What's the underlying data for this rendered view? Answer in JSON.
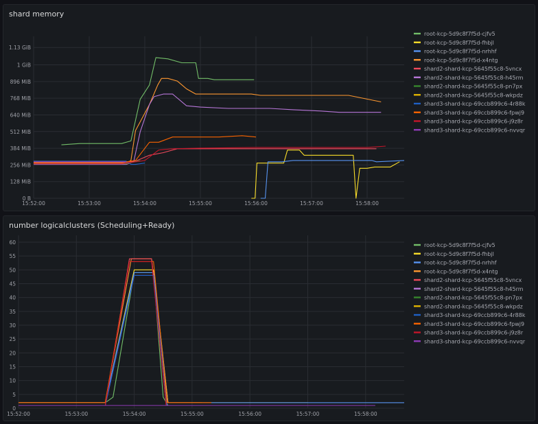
{
  "panels": [
    {
      "title": "shard memory"
    },
    {
      "title": "number logicalclusters (Scheduling+Ready)"
    }
  ],
  "chart_data": [
    {
      "type": "line",
      "title": "shard memory",
      "x_ticks": [
        "15:52:00",
        "15:53:00",
        "15:54:00",
        "15:55:00",
        "15:56:00",
        "15:57:00",
        "15:58:00"
      ],
      "y_ticks": [
        "0 B",
        "128 MiB",
        "256 MiB",
        "384 MiB",
        "512 MiB",
        "640 MiB",
        "768 MiB",
        "896 MiB",
        "1 GiB",
        "1.13 GiB"
      ],
      "y_unit": "MiB",
      "ylim": [
        0,
        1190
      ],
      "x_range": [
        "15:52:00",
        "15:58:40"
      ],
      "grid": true,
      "legend_position": "right",
      "series": [
        {
          "name": "root-kcp-5d9c8f7f5d-cjfv5",
          "color": "#73bf69",
          "points": [
            [
              "15:52:30",
              410
            ],
            [
              "15:52:50",
              420
            ],
            [
              "15:53:35",
              420
            ],
            [
              "15:53:45",
              440
            ],
            [
              "15:53:55",
              760
            ],
            [
              "15:54:05",
              870
            ],
            [
              "15:54:12",
              1080
            ],
            [
              "15:54:25",
              1070
            ],
            [
              "15:54:40",
              1040
            ],
            [
              "15:54:55",
              1040
            ],
            [
              "15:54:58",
              920
            ],
            [
              "15:55:08",
              920
            ],
            [
              "15:55:15",
              910
            ],
            [
              "15:55:58",
              910
            ]
          ]
        },
        {
          "name": "root-kcp-5d9c8f7f5d-fhbjl",
          "color": "#fade2a",
          "points": [
            [
              "15:55:55",
              0
            ],
            [
              "15:55:59",
              0
            ],
            [
              "15:56:01",
              270
            ],
            [
              "15:56:30",
              270
            ],
            [
              "15:56:34",
              370
            ],
            [
              "15:56:47",
              370
            ],
            [
              "15:56:52",
              330
            ],
            [
              "15:57:30",
              330
            ],
            [
              "15:57:45",
              330
            ],
            [
              "15:57:48",
              0
            ],
            [
              "15:57:52",
              230
            ],
            [
              "15:58:00",
              230
            ],
            [
              "15:58:08",
              240
            ],
            [
              "15:58:25",
              240
            ],
            [
              "15:58:35",
              280
            ]
          ]
        },
        {
          "name": "root-kcp-5d9c8f7f5d-nrhhf",
          "color": "#5794f2",
          "points": [
            [
              "15:56:05",
              0
            ],
            [
              "15:56:10",
              0
            ],
            [
              "15:56:13",
              280
            ],
            [
              "15:56:28",
              280
            ],
            [
              "15:56:40",
              290
            ],
            [
              "15:57:25",
              290
            ],
            [
              "15:57:48",
              290
            ],
            [
              "15:58:00",
              290
            ],
            [
              "15:58:05",
              290
            ],
            [
              "15:58:10",
              280
            ],
            [
              "15:58:40",
              290
            ]
          ]
        },
        {
          "name": "root-kcp-5d9c8f7f5d-x4ntg",
          "color": "#ff9830",
          "points": [
            [
              "15:52:00",
              270
            ],
            [
              "15:53:40",
              270
            ],
            [
              "15:53:45",
              290
            ],
            [
              "15:53:50",
              520
            ],
            [
              "15:54:05",
              720
            ],
            [
              "15:54:14",
              870
            ],
            [
              "15:54:18",
              920
            ],
            [
              "15:54:25",
              920
            ],
            [
              "15:54:35",
              900
            ],
            [
              "15:54:45",
              840
            ],
            [
              "15:54:55",
              800
            ],
            [
              "15:55:55",
              800
            ],
            [
              "15:56:05",
              790
            ],
            [
              "15:57:40",
              790
            ],
            [
              "15:58:15",
              740
            ]
          ]
        },
        {
          "name": "shard2-shard-kcp-5645f55c8-5vncx",
          "color": "#f2495c",
          "points": [
            [
              "15:52:00",
              275
            ],
            [
              "15:53:35",
              275
            ],
            [
              "15:53:50",
              285
            ],
            [
              "15:54:05",
              330
            ],
            [
              "15:54:20",
              350
            ],
            [
              "15:54:35",
              380
            ],
            [
              "15:55:00",
              380
            ],
            [
              "15:56:30",
              380
            ],
            [
              "15:57:30",
              380
            ],
            [
              "15:58:10",
              380
            ]
          ]
        },
        {
          "name": "shard2-shard-kcp-5645f55c8-h45rm",
          "color": "#b877d9",
          "points": [
            [
              "15:52:00",
              260
            ],
            [
              "15:53:40",
              260
            ],
            [
              "15:53:48",
              280
            ],
            [
              "15:53:55",
              510
            ],
            [
              "15:54:05",
              720
            ],
            [
              "15:54:10",
              780
            ],
            [
              "15:54:20",
              800
            ],
            [
              "15:54:30",
              800
            ],
            [
              "15:54:45",
              710
            ],
            [
              "15:55:00",
              700
            ],
            [
              "15:55:30",
              690
            ],
            [
              "15:55:45",
              690
            ],
            [
              "15:56:15",
              690
            ],
            [
              "15:56:40",
              680
            ],
            [
              "15:57:10",
              670
            ],
            [
              "15:57:30",
              660
            ],
            [
              "15:58:00",
              660
            ],
            [
              "15:58:15",
              660
            ]
          ]
        },
        {
          "name": "shard2-shard-kcp-5645f55c8-pn7px",
          "color": "#37872d",
          "points": [
            [
              "15:52:00",
              265
            ],
            [
              "15:53:40",
              265
            ],
            [
              "15:53:55",
              290
            ]
          ]
        },
        {
          "name": "shard2-shard-kcp-5645f55c8-wkpdz",
          "color": "#e0b400",
          "points": [
            [
              "15:52:00",
              285
            ],
            [
              "15:53:40",
              285
            ]
          ]
        },
        {
          "name": "shard3-shard-kcp-69ccb899c6-4r88k",
          "color": "#1f60c4",
          "points": [
            [
              "15:52:00",
              285
            ],
            [
              "15:53:40",
              285
            ],
            [
              "15:53:45",
              260
            ],
            [
              "15:53:50",
              260
            ],
            [
              "15:54:00",
              270
            ]
          ]
        },
        {
          "name": "shard3-shard-kcp-69ccb899c6-fpwj9",
          "color": "#fa6400",
          "points": [
            [
              "15:52:00",
              275
            ],
            [
              "15:53:35",
              275
            ],
            [
              "15:53:50",
              290
            ],
            [
              "15:54:05",
              430
            ],
            [
              "15:54:15",
              430
            ],
            [
              "15:54:30",
              470
            ],
            [
              "15:54:45",
              470
            ],
            [
              "15:55:20",
              470
            ],
            [
              "15:55:45",
              480
            ],
            [
              "15:56:00",
              470
            ]
          ]
        },
        {
          "name": "shard3-shard-kcp-69ccb899c6-j9z8r",
          "color": "#c4162a",
          "points": [
            [
              "15:52:00",
              265
            ],
            [
              "15:53:35",
              265
            ],
            [
              "15:54:00",
              290
            ],
            [
              "15:54:15",
              370
            ],
            [
              "15:54:30",
              380
            ],
            [
              "15:55:00",
              385
            ],
            [
              "15:56:00",
              390
            ],
            [
              "15:57:00",
              390
            ],
            [
              "15:58:00",
              390
            ],
            [
              "15:58:20",
              400
            ]
          ]
        },
        {
          "name": "shard3-shard-kcp-69ccb899c6-nvvqr",
          "color": "#8f3bb8",
          "points": [
            [
              "15:52:00",
              280
            ],
            [
              "15:53:40",
              280
            ]
          ]
        }
      ]
    },
    {
      "type": "line",
      "title": "number logicalclusters (Scheduling+Ready)",
      "x_ticks": [
        "15:52:00",
        "15:53:00",
        "15:54:00",
        "15:55:00",
        "15:56:00",
        "15:57:00",
        "15:58:00"
      ],
      "y_ticks": [
        "0",
        "5",
        "10",
        "15",
        "20",
        "25",
        "30",
        "35",
        "40",
        "45",
        "50",
        "55",
        "60"
      ],
      "ylim": [
        0,
        60
      ],
      "x_range": [
        "15:52:00",
        "15:58:40"
      ],
      "grid": true,
      "legend_position": "right",
      "series": [
        {
          "name": "root-kcp-5d9c8f7f5d-cjfv5",
          "color": "#73bf69",
          "points": [
            [
              "15:52:00",
              2
            ],
            [
              "15:53:30",
              2
            ],
            [
              "15:53:38",
              4
            ],
            [
              "15:54:00",
              49
            ],
            [
              "15:54:20",
              49
            ],
            [
              "15:54:30",
              4
            ],
            [
              "15:54:35",
              1
            ],
            [
              "15:55:50",
              1
            ]
          ]
        },
        {
          "name": "root-kcp-5d9c8f7f5d-fhbjl",
          "color": "#fade2a",
          "points": [
            [
              "15:52:00",
              2
            ],
            [
              "15:53:30",
              2
            ],
            [
              "15:54:00",
              50
            ],
            [
              "15:54:20",
              50
            ],
            [
              "15:54:35",
              2
            ],
            [
              "15:55:50",
              2
            ],
            [
              "15:56:00",
              2
            ],
            [
              "15:57:00",
              2
            ]
          ]
        },
        {
          "name": "root-kcp-5d9c8f7f5d-nrhhf",
          "color": "#5794f2",
          "points": [
            [
              "15:52:00",
              2
            ],
            [
              "15:53:30",
              2
            ],
            [
              "15:54:00",
              49
            ],
            [
              "15:54:20",
              49
            ],
            [
              "15:54:35",
              2
            ],
            [
              "15:56:00",
              2
            ],
            [
              "15:57:00",
              2
            ],
            [
              "15:58:00",
              2
            ],
            [
              "15:58:40",
              2
            ]
          ]
        },
        {
          "name": "root-kcp-5d9c8f7f5d-x4ntg",
          "color": "#ff9830",
          "points": [
            [
              "15:52:00",
              2
            ],
            [
              "15:53:30",
              2
            ],
            [
              "15:53:57",
              54
            ],
            [
              "15:54:18",
              54
            ],
            [
              "15:54:35",
              2
            ],
            [
              "15:55:10",
              2
            ]
          ]
        },
        {
          "name": "shard2-shard-kcp-5645f55c8-5vncx",
          "color": "#f2495c",
          "points": [
            [
              "15:52:00",
              1
            ],
            [
              "15:53:30",
              1
            ],
            [
              "15:53:55",
              54
            ],
            [
              "15:54:18",
              54
            ],
            [
              "15:54:34",
              1
            ],
            [
              "15:55:10",
              1
            ]
          ]
        },
        {
          "name": "shard2-shard-kcp-5645f55c8-h45rm",
          "color": "#b877d9",
          "points": [
            [
              "15:52:00",
              1
            ],
            [
              "15:53:30",
              1
            ],
            [
              "15:54:00",
              48
            ],
            [
              "15:54:20",
              48
            ],
            [
              "15:54:34",
              1
            ],
            [
              "15:57:00",
              1
            ]
          ]
        },
        {
          "name": "shard2-shard-kcp-5645f55c8-pn7px",
          "color": "#37872d",
          "points": [
            [
              "15:52:00",
              1
            ],
            [
              "15:53:30",
              1
            ]
          ]
        },
        {
          "name": "shard2-shard-kcp-5645f55c8-wkpdz",
          "color": "#e0b400",
          "points": [
            [
              "15:52:00",
              1
            ],
            [
              "15:53:30",
              1
            ]
          ]
        },
        {
          "name": "shard3-shard-kcp-69ccb899c6-4r88k",
          "color": "#1f60c4",
          "points": [
            [
              "15:52:00",
              1
            ],
            [
              "15:53:30",
              1
            ],
            [
              "15:54:00",
              48
            ],
            [
              "15:54:20",
              48
            ],
            [
              "15:54:34",
              1
            ],
            [
              "15:56:30",
              1
            ]
          ]
        },
        {
          "name": "shard3-shard-kcp-69ccb899c6-fpwj9",
          "color": "#fa6400",
          "points": [
            [
              "15:52:00",
              2
            ],
            [
              "15:53:30",
              2
            ],
            [
              "15:53:55",
              53
            ],
            [
              "15:54:20",
              53
            ],
            [
              "15:54:34",
              2
            ],
            [
              "15:55:20",
              2
            ]
          ]
        },
        {
          "name": "shard3-shard-kcp-69ccb899c6-j9z8r",
          "color": "#c4162a",
          "points": [
            [
              "15:52:00",
              1
            ],
            [
              "15:53:30",
              1
            ],
            [
              "15:53:55",
              53
            ],
            [
              "15:54:18",
              53
            ],
            [
              "15:54:33",
              1
            ],
            [
              "15:57:00",
              1
            ],
            [
              "15:58:00",
              1
            ]
          ]
        },
        {
          "name": "shard3-shard-kcp-69ccb899c6-nvvqr",
          "color": "#8f3bb8",
          "points": [
            [
              "15:52:00",
              1
            ],
            [
              "15:53:30",
              1
            ],
            [
              "15:57:00",
              1
            ],
            [
              "15:58:10",
              1
            ]
          ]
        }
      ]
    }
  ]
}
